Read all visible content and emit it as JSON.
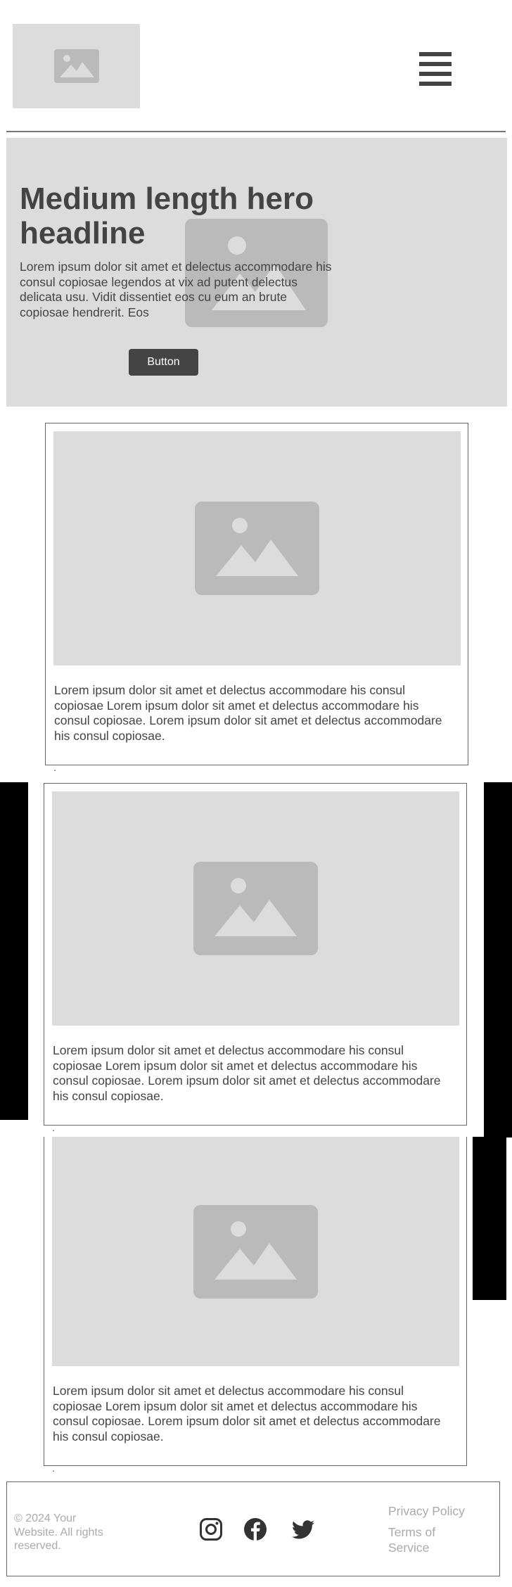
{
  "header": {
    "logo_icon": "image-placeholder-icon",
    "menu_icon": "hamburger-menu-icon"
  },
  "hero": {
    "title": "Medium length hero headline",
    "text": "Lorem ipsum dolor sit amet et delectus accommodare his consul copiosae legendos at vix ad putent delectus delicata usu. Vidit dissentiet eos cu eum an brute copiosae hendrerit. Eos",
    "button_label": "Button",
    "image_icon": "image-placeholder-icon"
  },
  "cards": [
    {
      "image_icon": "image-placeholder-icon",
      "text": "Lorem ipsum dolor sit amet et delectus accommodare his consul copiosae  Lorem ipsum dolor sit amet et delectus accommodare his consul copiosae.  Lorem ipsum dolor sit amet et delectus accommodare his consul copiosae.",
      "dot": "."
    },
    {
      "image_icon": "image-placeholder-icon",
      "text": "Lorem ipsum dolor sit amet et delectus accommodare his consul copiosae  Lorem ipsum dolor sit amet et delectus accommodare his consul copiosae.  Lorem ipsum dolor sit amet et delectus accommodare his consul copiosae.",
      "dot": "."
    },
    {
      "image_icon": "image-placeholder-icon",
      "text": "Lorem ipsum dolor sit amet et delectus accommodare his consul copiosae  Lorem ipsum dolor sit amet et delectus accommodare his consul copiosae.  Lorem ipsum dolor sit amet et delectus accommodare his consul copiosae.",
      "dot": "."
    }
  ],
  "footer": {
    "copyright": "© 2024 Your Website. All rights reserved.",
    "social_icons": [
      "instagram-icon",
      "facebook-icon",
      "twitter-icon"
    ],
    "links": [
      "Privacy Policy",
      "Terms of Service"
    ]
  },
  "colors": {
    "placeholder_bg": "#dcdcdc",
    "placeholder_icon": "#bababa",
    "dark_text": "#444444",
    "muted_text": "#aaaaaa"
  }
}
